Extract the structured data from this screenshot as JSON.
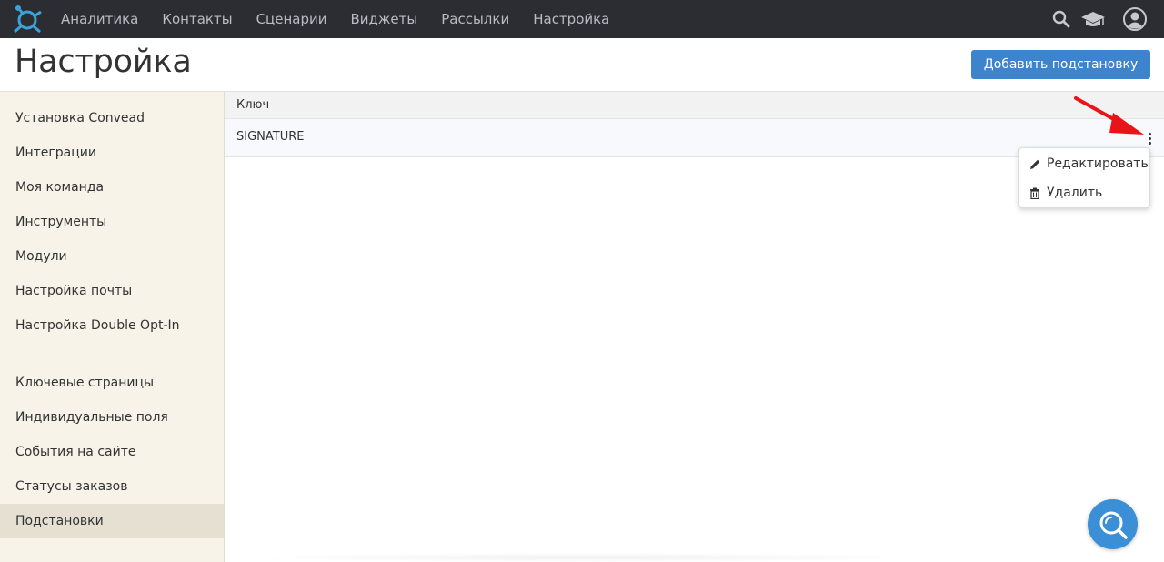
{
  "nav": {
    "items": [
      "Аналитика",
      "Контакты",
      "Сценарии",
      "Виджеты",
      "Рассылки",
      "Настройка"
    ]
  },
  "header": {
    "title": "Настройка",
    "add_button_label": "Добавить подстановку"
  },
  "sidebar": {
    "group1": [
      "Установка Convead",
      "Интеграции",
      "Моя команда",
      "Инструменты",
      "Модули",
      "Настройка почты",
      "Настройка Double Opt-In"
    ],
    "group2": [
      "Ключевые страницы",
      "Индивидуальные поля",
      "События на сайте",
      "Статусы заказов",
      "Подстановки"
    ],
    "active_item": "Подстановки"
  },
  "table": {
    "columns": [
      "Ключ"
    ],
    "rows": [
      {
        "key": "SIGNATURE"
      }
    ]
  },
  "row_menu": {
    "edit_label": "Редактировать",
    "delete_label": "Удалить"
  },
  "icons": {
    "logo": "convead-logo-icon",
    "search": "search-icon",
    "academy": "graduation-cap-icon",
    "profile": "user-avatar-icon",
    "more": "kebab-menu-icon",
    "edit": "pencil-icon",
    "delete": "trash-icon",
    "help": "search-help-icon",
    "annotation": "red-arrow-icon"
  },
  "colors": {
    "topbar": "#2b2d33",
    "primary_button": "#3d84cc",
    "sidebar_bg": "#f7f3e8",
    "sidebar_active": "#e6e0d3",
    "help_button": "#3a8fd6",
    "annotation_arrow": "#e8141a"
  }
}
